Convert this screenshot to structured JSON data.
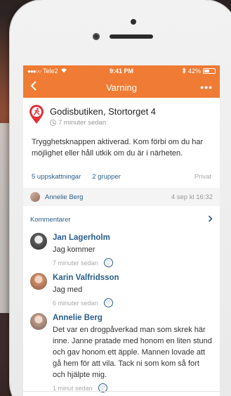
{
  "status": {
    "carrier": "Tele2",
    "time": "9:41 PM",
    "battery": "42%"
  },
  "nav": {
    "back": "<",
    "title": "Varning",
    "more": "•••"
  },
  "alert": {
    "title": "Godisbutiken, Stortorget 4",
    "time": "7 minuter sedan",
    "description": "Trygghetsknappen aktiverad. Kom förbi om du har möjlighet eller håll utkik om du är i närheten.",
    "acknowledgements": "5 uppskattningar",
    "groups": "2 grupper",
    "visibility": "Privat"
  },
  "author": {
    "name": "Annelie Berg",
    "date": "4 sep kl 16:32"
  },
  "comments_header": "Kommentarer",
  "comments": [
    {
      "name": "Jan Lagerholm",
      "text": "Jag kommer",
      "time": "7 minuter sedan"
    },
    {
      "name": "Karin Valfridsson",
      "text": "Jag med",
      "time": "6 minuter sedan"
    },
    {
      "name": "Annelie Berg",
      "text": "Det var en drogpåverkad man som skrek här inne. Janne pratade med honom en liten stund och gav honom ett äpple. Mannen lovade att gå hem för att vila. Tack ni som kom så fort och hjälpte mig.",
      "time": "1 minut sedan"
    }
  ],
  "colors": {
    "accent": "#ef7b34",
    "link": "#2a5d8a",
    "alert_red": "#e0313a"
  }
}
